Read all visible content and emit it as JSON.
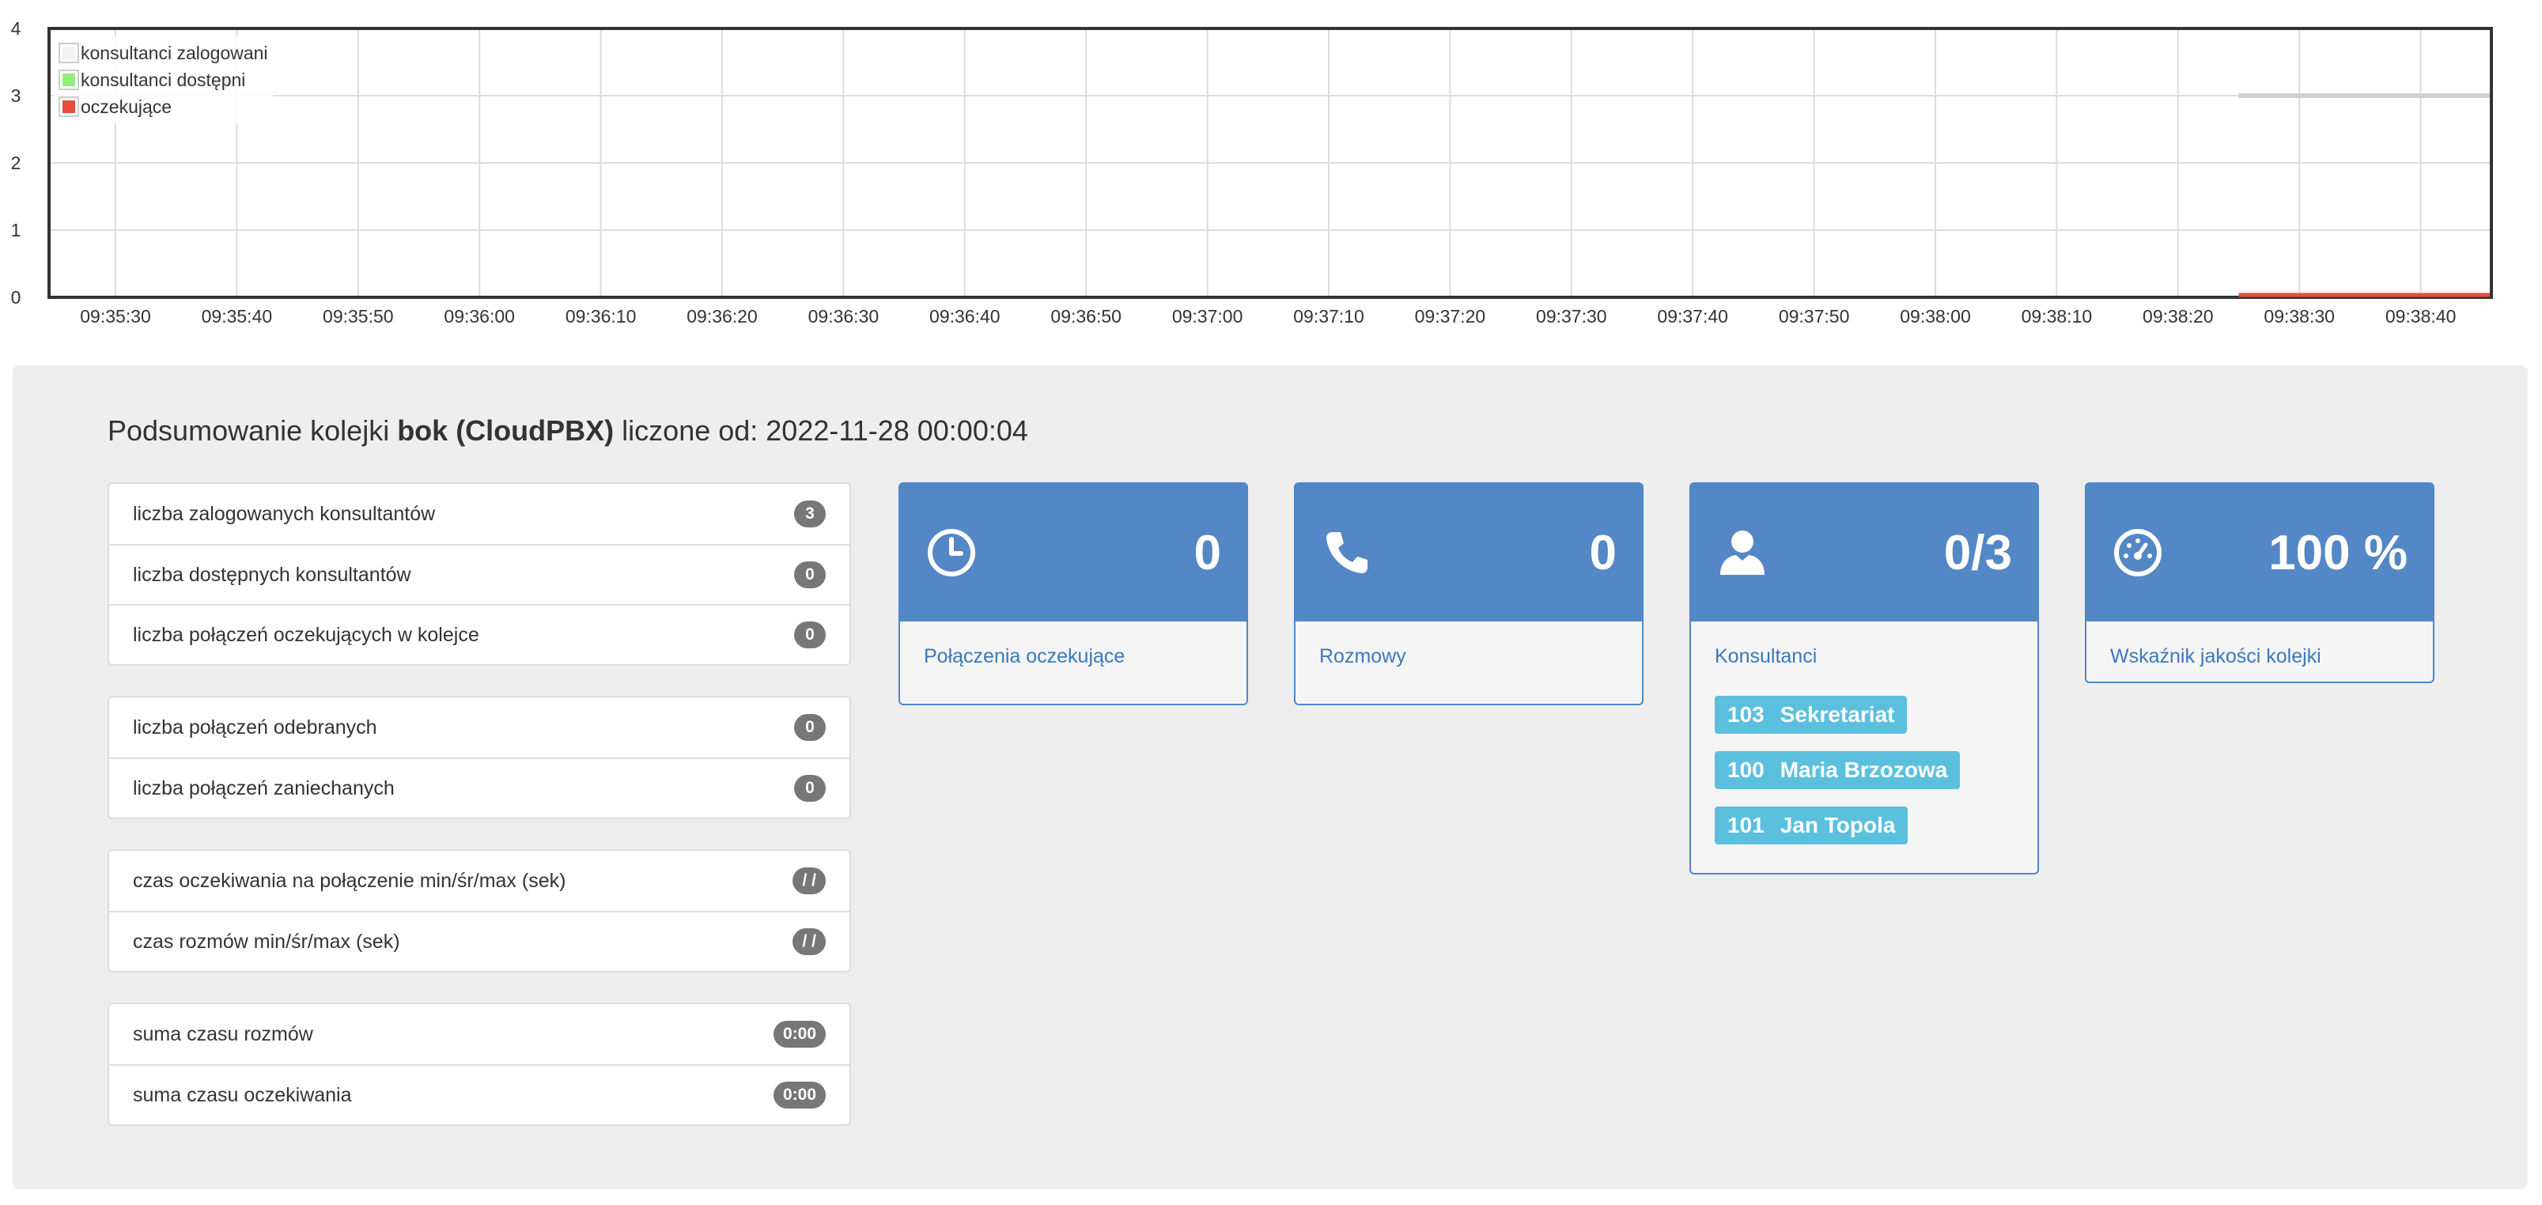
{
  "chart_data": {
    "type": "line",
    "y_ticks": [
      "0",
      "1",
      "2",
      "3",
      "4"
    ],
    "ylim": [
      0,
      4
    ],
    "x_ticks": [
      "09:35:30",
      "09:35:40",
      "09:35:50",
      "09:36:00",
      "09:36:10",
      "09:36:20",
      "09:36:30",
      "09:36:40",
      "09:36:50",
      "09:37:00",
      "09:37:10",
      "09:37:20",
      "09:37:30",
      "09:37:40",
      "09:37:50",
      "09:38:00",
      "09:38:10",
      "09:38:20",
      "09:38:30",
      "09:38:40"
    ],
    "grid": true,
    "legend_position": "top-left",
    "series": [
      {
        "name": "konsultanci zalogowani",
        "color": "#d0d0d0",
        "x_start": "09:38:25",
        "x_end": "09:38:46",
        "value": 3
      },
      {
        "name": "konsultanci dostępni",
        "color": "#90ee7e",
        "x_start": "09:38:25",
        "x_end": "09:38:46",
        "value": 0
      },
      {
        "name": "oczekujące",
        "color": "#e74c3c",
        "x_start": "09:38:25",
        "x_end": "09:38:46",
        "value": 0
      }
    ]
  },
  "summary": {
    "title_prefix": "Podsumowanie kolejki ",
    "queue_name": "bok (CloudPBX)",
    "title_suffix": " liczone od: 2022-11-28 00:00:04"
  },
  "stats_groups": [
    [
      {
        "label": "liczba zalogowanych konsultantów",
        "value": "3"
      },
      {
        "label": "liczba dostępnych konsultantów",
        "value": "0"
      },
      {
        "label": "liczba połączeń oczekujących w kolejce",
        "value": "0"
      }
    ],
    [
      {
        "label": "liczba połączeń odebranych",
        "value": "0"
      },
      {
        "label": "liczba połączeń zaniechanych",
        "value": "0"
      }
    ],
    [
      {
        "label": "czas oczekiwania na połączenie min/śr/max (sek)",
        "value": "/ /"
      },
      {
        "label": "czas rozmów min/śr/max (sek)",
        "value": "/ /"
      }
    ],
    [
      {
        "label": "suma czasu rozmów",
        "value": "0:00"
      },
      {
        "label": "suma czasu oczekiwania",
        "value": "0:00"
      }
    ]
  ],
  "tiles": {
    "waiting": {
      "icon": "clock-icon",
      "value": "0",
      "label": "Połączenia oczekujące"
    },
    "calls": {
      "icon": "phone-icon",
      "value": "0",
      "label": "Rozmowy"
    },
    "agents": {
      "icon": "user-icon",
      "value": "0/3",
      "label": "Konsultanci",
      "list": [
        {
          "ext": "103",
          "name": "Sekretariat"
        },
        {
          "ext": "100",
          "name": "Maria Brzozowa"
        },
        {
          "ext": "101",
          "name": "Jan Topola"
        }
      ]
    },
    "quality": {
      "icon": "gauge-icon",
      "value": "100 %",
      "label": "Wskaźnik jakości kolejki"
    }
  },
  "colors": {
    "tile_header": "#5487c5",
    "tile_border": "#4e87c9",
    "badge": "#777777",
    "agent_tag": "#5bc0de",
    "link": "#3a79bd"
  }
}
